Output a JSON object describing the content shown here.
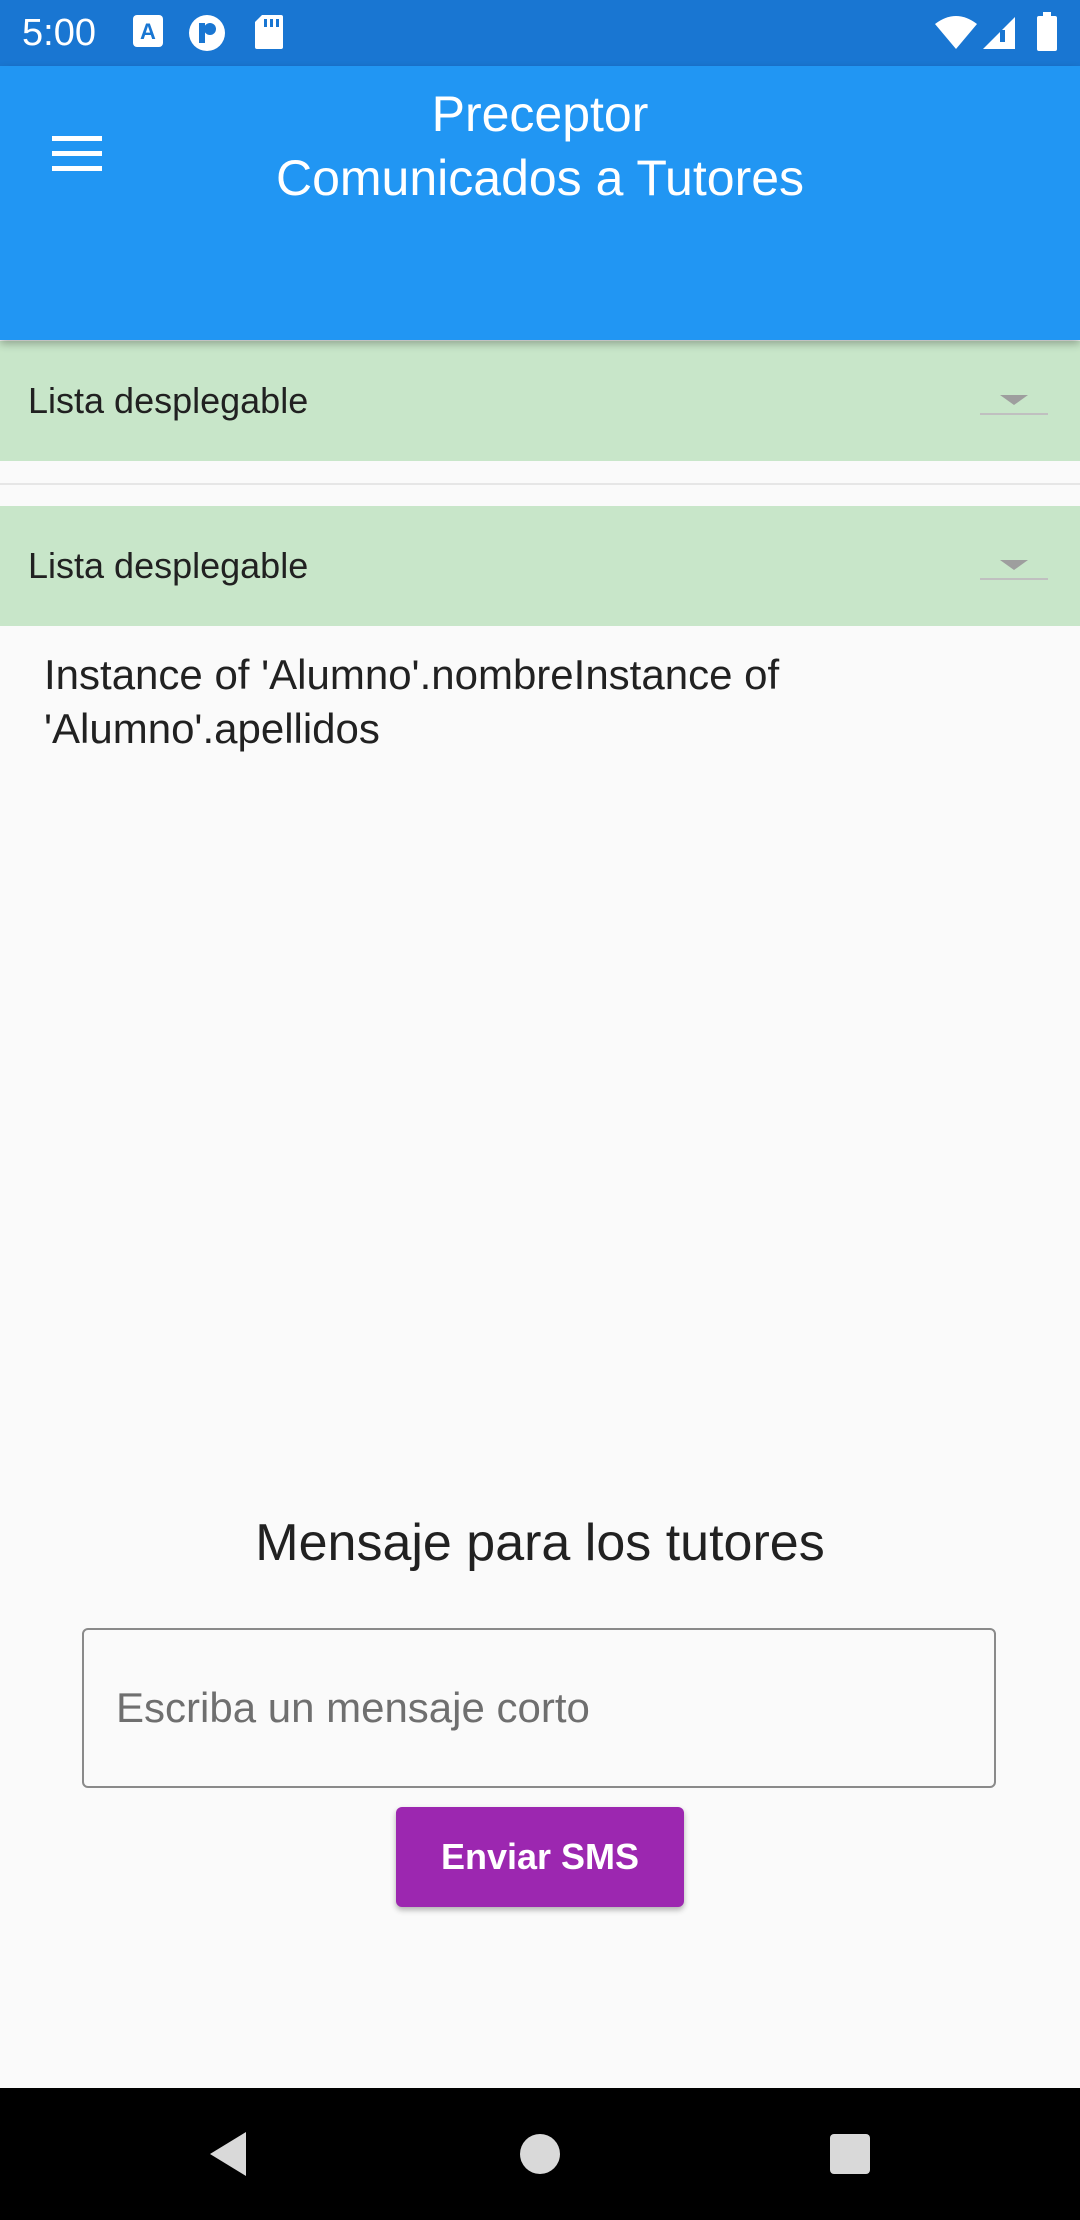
{
  "status_bar": {
    "time": "5:00",
    "left_icons": [
      "text-a-icon",
      "app-p-icon",
      "sd-card-icon"
    ],
    "right_icons": [
      "wifi-icon",
      "signal-icon",
      "battery-icon"
    ]
  },
  "app_bar": {
    "title_line1": "Preceptor",
    "title_line2": "Comunicados a Tutores",
    "color": "#2196f3"
  },
  "dropdowns": [
    {
      "label": "Lista desplegable"
    },
    {
      "label": "Lista desplegable"
    }
  ],
  "selected_student": {
    "text": "Instance of 'Alumno'.nombreInstance of 'Alumno'.apellidos"
  },
  "message": {
    "heading": "Mensaje para los tutores",
    "placeholder": "Escriba un mensaje corto",
    "value": ""
  },
  "send_button": {
    "label": "Enviar SMS",
    "color": "#9c27b0"
  },
  "nav_bar": {
    "buttons": [
      "back-icon",
      "home-icon",
      "recents-icon"
    ]
  },
  "colors": {
    "status_bar": "#1976d2",
    "dropdown_bg": "#c8e6c9",
    "background": "#fafafa"
  }
}
